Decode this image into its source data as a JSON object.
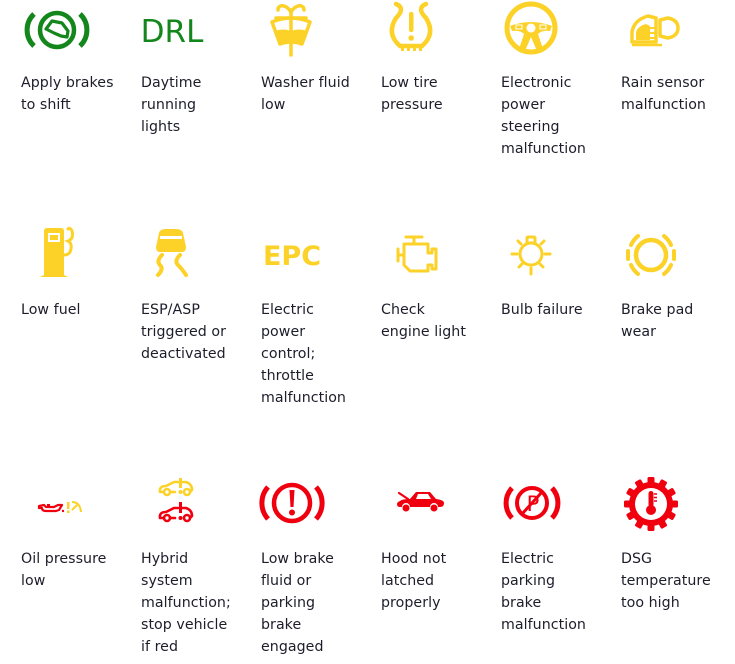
{
  "colors": {
    "green": "#14871c",
    "yellow": "#fcd229",
    "red": "#f0000f",
    "text": "#1d1d2b"
  },
  "indicators": [
    {
      "icon": "apply-brakes-icon",
      "icon_text": "",
      "color": "green",
      "lines": [
        "Apply brakes",
        "to shift"
      ]
    },
    {
      "icon": "drl-icon",
      "icon_text": "DRL",
      "color": "green",
      "lines": [
        "Daytime",
        "running",
        "lights"
      ]
    },
    {
      "icon": "washer-fluid-icon",
      "icon_text": "",
      "color": "yellow",
      "lines": [
        "Washer fluid",
        "low"
      ]
    },
    {
      "icon": "tire-pressure-icon",
      "icon_text": "",
      "color": "yellow",
      "lines": [
        "Low tire",
        "pressure"
      ]
    },
    {
      "icon": "steering-wheel-icon",
      "icon_text": "",
      "color": "yellow",
      "lines": [
        "Electronic",
        "power",
        "steering",
        "malfunction"
      ]
    },
    {
      "icon": "rain-sensor-icon",
      "icon_text": "",
      "color": "yellow",
      "lines": [
        "Rain sensor",
        "malfunction"
      ]
    },
    {
      "icon": "fuel-pump-icon",
      "icon_text": "",
      "color": "yellow",
      "lines": [
        "Low fuel"
      ]
    },
    {
      "icon": "esp-skid-icon",
      "icon_text": "",
      "color": "yellow",
      "lines": [
        "ESP/ASP",
        "triggered or",
        "deactivated"
      ]
    },
    {
      "icon": "epc-icon",
      "icon_text": "EPC",
      "color": "yellow",
      "lines": [
        "Electric",
        "power",
        "control;",
        "throttle",
        "malfunction"
      ]
    },
    {
      "icon": "engine-icon",
      "icon_text": "",
      "color": "yellow",
      "lines": [
        "Check",
        "engine light"
      ]
    },
    {
      "icon": "bulb-icon",
      "icon_text": "",
      "color": "yellow",
      "lines": [
        "Bulb failure"
      ]
    },
    {
      "icon": "brake-pad-icon",
      "icon_text": "",
      "color": "yellow",
      "lines": [
        "Brake pad",
        "wear"
      ]
    },
    {
      "icon": "oil-pressure-icon",
      "icon_text": "",
      "color": "red",
      "lines": [
        "Oil pressure",
        "low"
      ]
    },
    {
      "icon": "hybrid-system-icon",
      "icon_text": "",
      "color": "red",
      "lines": [
        "Hybrid",
        "system",
        "malfunction;",
        "stop vehicle",
        "if red"
      ]
    },
    {
      "icon": "brake-warning-icon",
      "icon_text": "",
      "color": "red",
      "lines": [
        "Low brake",
        "fluid or",
        "parking",
        "brake",
        "engaged"
      ]
    },
    {
      "icon": "hood-open-icon",
      "icon_text": "",
      "color": "red",
      "lines": [
        "Hood not",
        "latched",
        "properly"
      ]
    },
    {
      "icon": "parking-brake-icon",
      "icon_text": "",
      "color": "red",
      "lines": [
        "Electric",
        "parking",
        "brake",
        "malfunction"
      ]
    },
    {
      "icon": "dsg-temperature-icon",
      "icon_text": "",
      "color": "red",
      "lines": [
        "DSG",
        "temperature",
        "too high"
      ]
    }
  ]
}
